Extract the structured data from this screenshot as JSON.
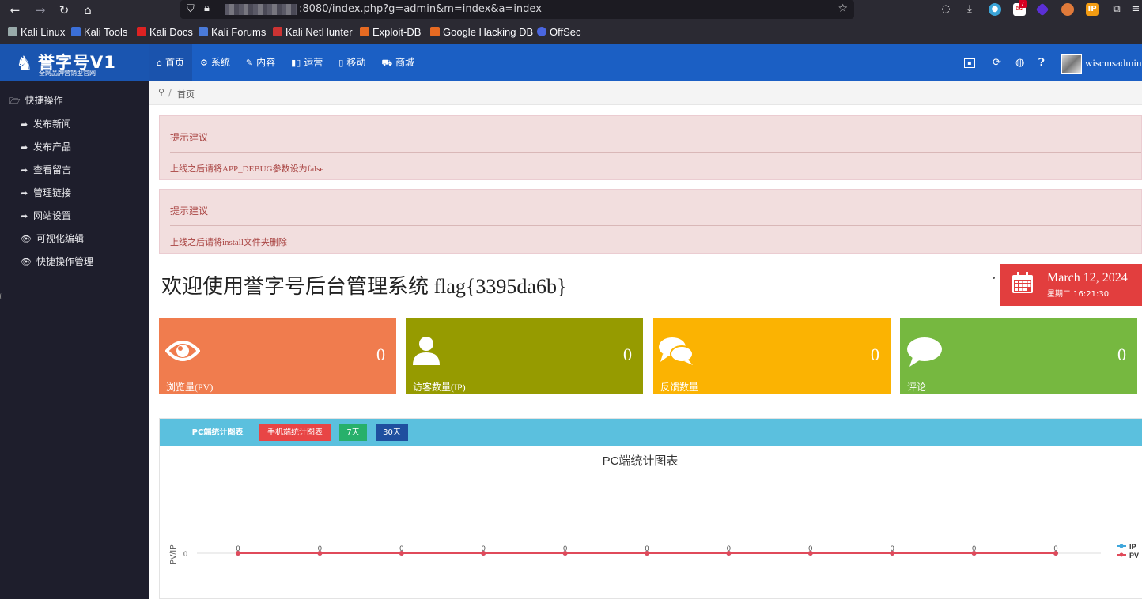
{
  "browser": {
    "url_suffix": ":8080/index.php?g=admin&m=index&a=index",
    "bookmarks": [
      "Kali Linux",
      "Kali Tools",
      "Kali Docs",
      "Kali Forums",
      "Kali NetHunter",
      "Exploit-DB",
      "Google Hacking DB",
      "OffSec"
    ],
    "badge_count": "7"
  },
  "header": {
    "brand": "誉字号V1",
    "brand_sub": "全网品牌营销型官网",
    "nav": [
      {
        "label": "首页",
        "icon": "home-icon"
      },
      {
        "label": "系统",
        "icon": "cogs-icon"
      },
      {
        "label": "内容",
        "icon": "edit-icon"
      },
      {
        "label": "运营",
        "icon": "bar-chart-icon"
      },
      {
        "label": "移动",
        "icon": "mobile-icon"
      },
      {
        "label": "商城",
        "icon": "cart-icon"
      }
    ],
    "username": "wiscmsadmin"
  },
  "sidebar": {
    "heading": "快捷操作",
    "items": [
      "发布新闻",
      "发布产品",
      "查看留言",
      "管理链接",
      "网站设置",
      "可视化编辑",
      "快捷操作管理"
    ]
  },
  "breadcrumb": {
    "home": "首页"
  },
  "tips": [
    {
      "title": "提示建议",
      "message": "上线之后请将APP_DEBUG参数设为false"
    },
    {
      "title": "提示建议",
      "message": "上线之后请将install文件夹删除"
    }
  ],
  "welcome": "欢迎使用誉字号后台管理系统 flag{3395da6b}",
  "date": {
    "main": "March 12, 2024",
    "sub": "星期二  16:21:30"
  },
  "stats": [
    {
      "label": "浏览量(PV)",
      "value": "0",
      "color": "#f07c4e",
      "icon": "eye-icon"
    },
    {
      "label": "访客数量(IP)",
      "value": "0",
      "color": "#969b00",
      "icon": "user-icon"
    },
    {
      "label": "反馈数量",
      "value": "0",
      "color": "#fbb302",
      "icon": "comments-icon"
    },
    {
      "label": "评论",
      "value": "0",
      "color": "#76b840",
      "icon": "comment-icon"
    }
  ],
  "chart_tabs": [
    "PC端统计图表",
    "手机端统计图表",
    "7天",
    "30天"
  ],
  "chart_data": {
    "type": "line",
    "title": "PC端统计图表",
    "ylabel": "PV/IP",
    "x": [
      "",
      "",
      "",
      "",
      "",
      "",
      "",
      "",
      "",
      "",
      ""
    ],
    "y_ticks": [
      0
    ],
    "series": [
      {
        "name": "IP",
        "values": [
          0,
          0,
          0,
          0,
          0,
          0,
          0,
          0,
          0,
          0,
          0
        ],
        "color": "#3fa7dc"
      },
      {
        "name": "PV",
        "values": [
          0,
          0,
          0,
          0,
          0,
          0,
          0,
          0,
          0,
          0,
          0
        ],
        "color": "#e04a5a"
      }
    ],
    "data_labels": true,
    "legend": "right"
  }
}
